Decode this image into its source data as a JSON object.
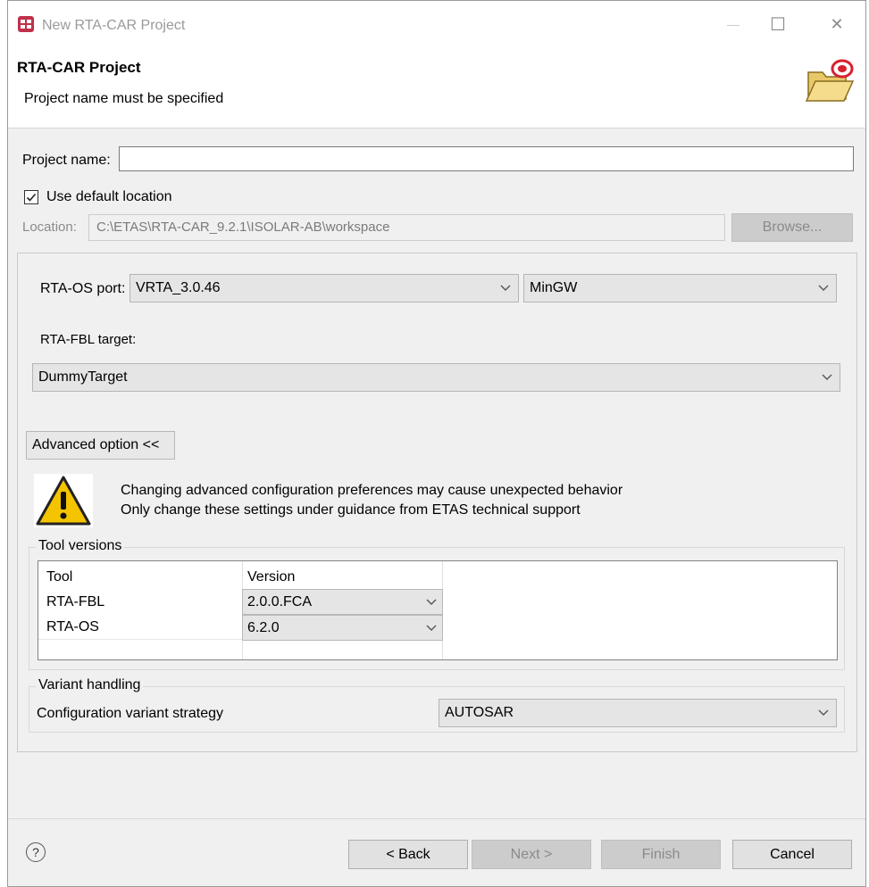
{
  "window": {
    "title": "New RTA-CAR Project",
    "icon": "rta-car-app-icon",
    "controls": {
      "minimize": "—",
      "maximize": "☐",
      "close": "✕"
    }
  },
  "header": {
    "title": "RTA-CAR Project",
    "message": "Project name must be specified",
    "icon": "open-folder-wizard-icon"
  },
  "project": {
    "name_label": "Project name:",
    "name_value": "",
    "use_default_label": "Use default location",
    "use_default_checked": true,
    "location_label": "Location:",
    "location_value": "C:\\ETAS\\RTA-CAR_9.2.1\\ISOLAR-AB\\workspace",
    "browse_label": "Browse..."
  },
  "settings": {
    "os_port_label": "RTA-OS port:",
    "os_port_value": "VRTA_3.0.46",
    "compiler_value": "MinGW",
    "fbl_target_label": "RTA-FBL target:",
    "fbl_target_value": "DummyTarget",
    "advanced_label": "Advanced option <<",
    "warning_line1": "Changing advanced configuration preferences may cause unexpected behavior",
    "warning_line2": "Only change these settings under guidance from ETAS technical support",
    "warning_icon": "warning-icon"
  },
  "tool_versions": {
    "group_label": "Tool versions",
    "columns": [
      "Tool",
      "Version"
    ],
    "rows": [
      {
        "tool": "RTA-FBL",
        "version": "2.0.0.FCA"
      },
      {
        "tool": "RTA-OS",
        "version": "6.2.0"
      }
    ]
  },
  "variant": {
    "group_label": "Variant handling",
    "strategy_label": "Configuration variant strategy",
    "strategy_value": "AUTOSAR"
  },
  "footer": {
    "help": "?",
    "back": "< Back",
    "next": "Next >",
    "finish": "Finish",
    "cancel": "Cancel"
  },
  "colors": {
    "dialog_bg": "#f0f0f0",
    "header_bg": "#ffffff",
    "disabled_button": "#cccccc",
    "warning_yellow": "#f5c400"
  }
}
